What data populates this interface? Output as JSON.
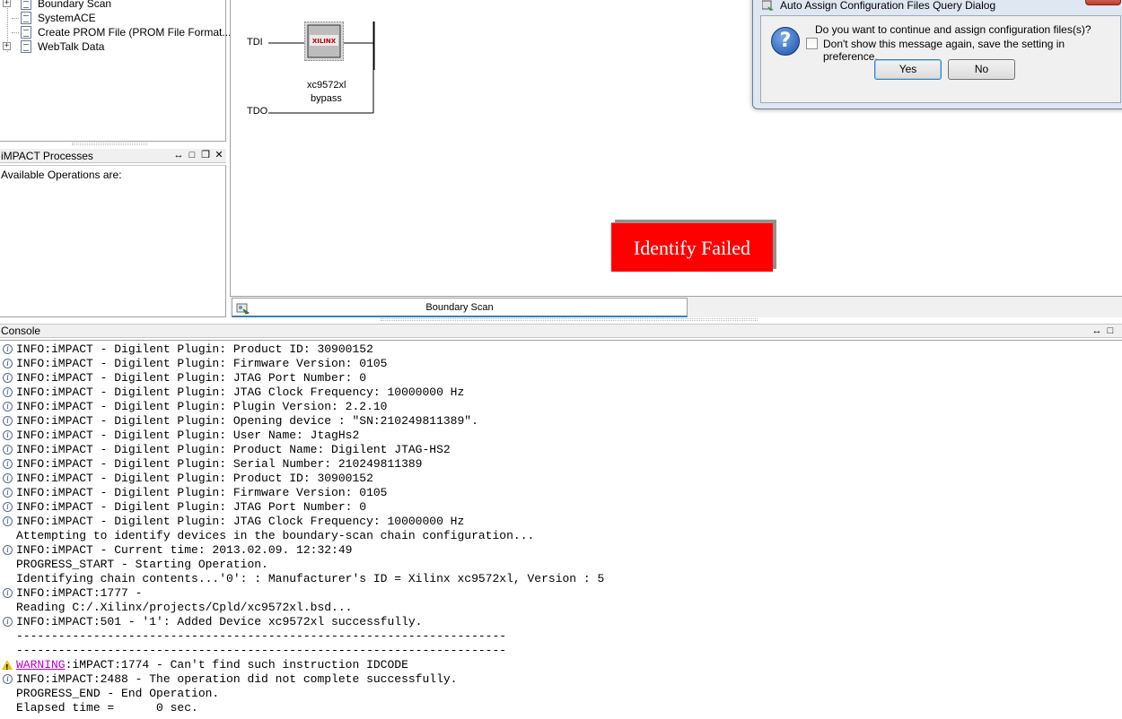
{
  "tree": {
    "items": [
      {
        "label": "Boundary Scan",
        "expandable": true,
        "icon": "boundary-scan-icon"
      },
      {
        "label": "SystemACE",
        "expandable": false,
        "icon": "document-icon"
      },
      {
        "label": "Create PROM File (PROM File Format...",
        "expandable": false,
        "icon": "document-icon"
      },
      {
        "label": "WebTalk Data",
        "expandable": true,
        "icon": "document-icon"
      }
    ]
  },
  "processes": {
    "title": "iMPACT Processes",
    "body_text": "Available Operations are:"
  },
  "canvas": {
    "tdi_label": "TDI",
    "tdo_label": "TDO",
    "chip_name": "xc9572xl",
    "chip_mode": "bypass",
    "chip_logo": "XILINX",
    "status_banner": "Identify Failed",
    "status_color": "#ff0000"
  },
  "tabs": [
    {
      "label": "Boundary Scan",
      "active": true
    }
  ],
  "console": {
    "title": "Console",
    "lines": [
      {
        "type": "info",
        "text": "INFO:iMPACT - Digilent Plugin: Product ID: 30900152"
      },
      {
        "type": "info",
        "text": "INFO:iMPACT - Digilent Plugin: Firmware Version: 0105"
      },
      {
        "type": "info",
        "text": "INFO:iMPACT - Digilent Plugin: JTAG Port Number: 0"
      },
      {
        "type": "info",
        "text": "INFO:iMPACT - Digilent Plugin: JTAG Clock Frequency: 10000000 Hz"
      },
      {
        "type": "info",
        "text": "INFO:iMPACT - Digilent Plugin: Plugin Version: 2.2.10"
      },
      {
        "type": "info",
        "text": "INFO:iMPACT - Digilent Plugin: Opening device : \"SN:210249811389\"."
      },
      {
        "type": "info",
        "text": "INFO:iMPACT - Digilent Plugin: User Name: JtagHs2"
      },
      {
        "type": "info",
        "text": "INFO:iMPACT - Digilent Plugin: Product Name: Digilent JTAG-HS2"
      },
      {
        "type": "info",
        "text": "INFO:iMPACT - Digilent Plugin: Serial Number: 210249811389"
      },
      {
        "type": "info",
        "text": "INFO:iMPACT - Digilent Plugin: Product ID: 30900152"
      },
      {
        "type": "info",
        "text": "INFO:iMPACT - Digilent Plugin: Firmware Version: 0105"
      },
      {
        "type": "info",
        "text": "INFO:iMPACT - Digilent Plugin: JTAG Port Number: 0"
      },
      {
        "type": "info",
        "text": "INFO:iMPACT - Digilent Plugin: JTAG Clock Frequency: 10000000 Hz"
      },
      {
        "type": "plain",
        "text": "Attempting to identify devices in the boundary-scan chain configuration..."
      },
      {
        "type": "info",
        "text": "INFO:iMPACT - Current time: 2013.02.09. 12:32:49"
      },
      {
        "type": "plain",
        "text": "PROGRESS_START - Starting Operation."
      },
      {
        "type": "plain",
        "text": "Identifying chain contents...'0': : Manufacturer's ID = Xilinx xc9572xl, Version : 5"
      },
      {
        "type": "info",
        "text": "INFO:iMPACT:1777 -"
      },
      {
        "type": "plain",
        "text": "Reading C:/.Xilinx/projects/Cpld/xc9572xl.bsd..."
      },
      {
        "type": "info",
        "text": "INFO:iMPACT:501 - '1': Added Device xc9572xl successfully."
      },
      {
        "type": "plain",
        "text": "----------------------------------------------------------------------"
      },
      {
        "type": "plain",
        "text": "----------------------------------------------------------------------"
      },
      {
        "type": "warning",
        "link": "WARNING",
        "text": ":iMPACT:1774 - Can't find such instruction IDCODE"
      },
      {
        "type": "info",
        "text": "INFO:iMPACT:2488 - The operation did not complete successfully."
      },
      {
        "type": "plain",
        "text": "PROGRESS_END - End Operation."
      },
      {
        "type": "plain",
        "text": "Elapsed time =      0 sec."
      }
    ]
  },
  "dialog": {
    "title": "Auto Assign Configuration Files Query Dialog",
    "message": "Do you want to continue and assign configuration files(s)?",
    "checkbox_label": "Don't show this message again, save the setting in preference.",
    "checkbox_checked": false,
    "yes_label": "Yes",
    "no_label": "No"
  }
}
